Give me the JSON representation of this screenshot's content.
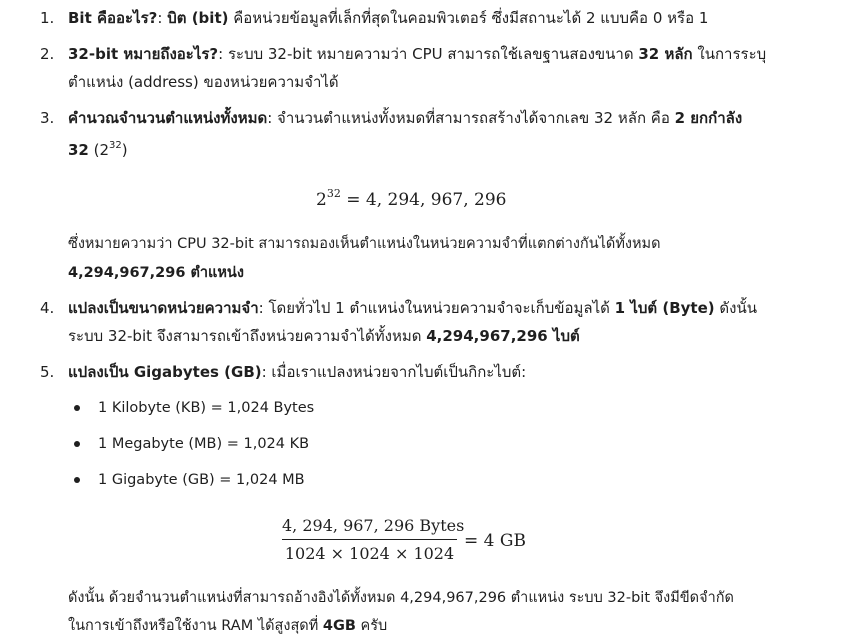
{
  "items": [
    {
      "num": "1.",
      "lines": [
        [
          {
            "b": true,
            "t": "Bit คืออะไร?"
          },
          {
            "b": false,
            "t": ": "
          },
          {
            "b": true,
            "t": "บิต (bit)"
          },
          {
            "b": false,
            "t": " คือหน่วยข้อมูลที่เล็กที่สุดในคอมพิวเตอร์ ซึ่งมีสถานะได้ 2 แบบคือ 0 หรือ 1"
          }
        ]
      ]
    },
    {
      "num": "2.",
      "lines": [
        [
          {
            "b": true,
            "t": "32-bit หมายถึงอะไร?"
          },
          {
            "b": false,
            "t": ": ระบบ 32-bit หมายความว่า CPU สามารถใช้เลขฐานสองขนาด "
          },
          {
            "b": true,
            "t": "32 หลัก"
          },
          {
            "b": false,
            "t": " ในการระบุ"
          }
        ],
        [
          {
            "b": false,
            "t": "ตำแหน่ง (address) ของหน่วยความจำได้"
          }
        ]
      ]
    },
    {
      "num": "3.",
      "lines": [
        [
          {
            "b": true,
            "t": "คำนวณจำนวนตำแหน่งทั้งหมด"
          },
          {
            "b": false,
            "t": ": จำนวนตำแหน่งทั้งหมดที่สามารถสร้างได้จากเลข 32 หลัก คือ "
          },
          {
            "b": true,
            "t": "2 ยกกำลัง"
          }
        ],
        [
          {
            "b": true,
            "t": "32"
          },
          {
            "b": false,
            "t": " (2"
          },
          {
            "b": false,
            "t": "32",
            "sup": true
          },
          {
            "b": false,
            "t": ")"
          }
        ]
      ]
    }
  ],
  "equation1": {
    "base": "2",
    "exp": "32",
    "rhs": " = 4, 294, 967, 296"
  },
  "para1": {
    "line1": "ซึ่งหมายความว่า CPU 32-bit สามารถมองเห็นตำแหน่งในหน่วยความจำที่แตกต่างกันได้ทั้งหมด",
    "line2": "4,294,967,296 ตำแหน่ง"
  },
  "items2": [
    {
      "num": "4.",
      "lines": [
        [
          {
            "b": true,
            "t": "แปลงเป็นขนาดหน่วยความจำ"
          },
          {
            "b": false,
            "t": ": โดยทั่วไป 1 ตำแหน่งในหน่วยความจำจะเก็บข้อมูลได้ "
          },
          {
            "b": true,
            "t": "1 ไบต์ (Byte)"
          },
          {
            "b": false,
            "t": " ดังนั้น"
          }
        ],
        [
          {
            "b": false,
            "t": "ระบบ 32-bit จึงสามารถเข้าถึงหน่วยความจำได้ทั้งหมด "
          },
          {
            "b": true,
            "t": "4,294,967,296 ไบต์"
          }
        ]
      ]
    },
    {
      "num": "5.",
      "lines": [
        [
          {
            "b": true,
            "t": "แปลงเป็น Gigabytes (GB)"
          },
          {
            "b": false,
            "t": ": เมื่อเราแปลงหน่วยจากไบต์เป็นกิกะไบต์:"
          }
        ]
      ]
    }
  ],
  "bullets": [
    "1 Kilobyte (KB) = 1,024 Bytes",
    "1 Megabyte (MB) = 1,024 KB",
    "1 Gigabyte (GB) = 1,024 MB"
  ],
  "fraction": {
    "numerator": "4, 294, 967, 296 Bytes",
    "denominator": "1024 × 1024 × 1024",
    "rhs": "= 4 GB"
  },
  "conclusion": {
    "line1": "ดังนั้น ด้วยจำนวนตำแหน่งที่สามารถอ้างอิงได้ทั้งหมด 4,294,967,296 ตำแหน่ง ระบบ 32-bit จึงมีขีดจำกัด",
    "line2_text": "ในการเข้าถึงหรือใช้งาน RAM ได้สูงสุดที่ ",
    "line2_bold": "4GB",
    "line2_tail": " ครับ"
  }
}
